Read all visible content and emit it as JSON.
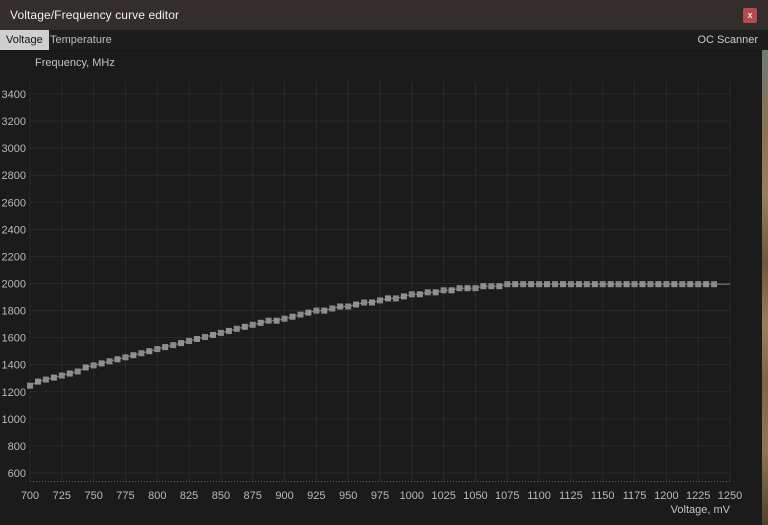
{
  "window": {
    "title": "Voltage/Frequency curve editor",
    "close_label": "x"
  },
  "tabs": {
    "voltage": "Voltage",
    "temperature": "Temperature",
    "oc_scanner": "OC Scanner"
  },
  "chart_data": {
    "type": "scatter",
    "title": "",
    "xlabel": "Voltage, mV",
    "ylabel": "Frequency, MHz",
    "xlim": [
      700,
      1250
    ],
    "ylim": [
      600,
      3400
    ],
    "grid": true,
    "legend": "none",
    "x_ticks": [
      700,
      725,
      750,
      775,
      800,
      825,
      850,
      875,
      900,
      925,
      950,
      975,
      1000,
      1025,
      1050,
      1075,
      1100,
      1125,
      1150,
      1175,
      1200,
      1225,
      1250
    ],
    "y_ticks": [
      3400,
      3200,
      3000,
      2800,
      2600,
      2400,
      2200,
      2000,
      1800,
      1600,
      1400,
      1200,
      1000,
      800,
      600
    ],
    "series": [
      {
        "name": "voltage-frequency-curve",
        "marker": "square",
        "marker_step_mv": 6.25,
        "freq_quantize_mhz": 15,
        "markers_end_mv": 1237.5,
        "line_end_mv": 1250,
        "points": [
          [
            700,
            1250.0
          ],
          [
            725,
            1321.6
          ],
          [
            750,
            1390.7
          ],
          [
            775,
            1457.1
          ],
          [
            800,
            1520.7
          ],
          [
            825,
            1581.3
          ],
          [
            850,
            1639.0
          ],
          [
            875,
            1693.6
          ],
          [
            900,
            1744.9
          ],
          [
            925,
            1792.8
          ],
          [
            950,
            1836.9
          ],
          [
            975,
            1877.2
          ],
          [
            1000,
            1913.2
          ],
          [
            1025,
            1944.6
          ],
          [
            1050,
            1970.5
          ],
          [
            1075,
            1990.0
          ],
          [
            1100,
            2000.0
          ],
          [
            1250,
            2000.0
          ]
        ]
      }
    ],
    "colors": {
      "background": "#1b1b1b",
      "grid": "#2a2a2a",
      "marker": "#919191",
      "marker_alt": "#898989",
      "line": "#7a7a7a",
      "tick_text": "#b9b9b9",
      "dotted_baseline": "#626262"
    }
  },
  "colors": {
    "titlebar": "#332e2b",
    "title_text": "#efefef",
    "close_button": "#b34b4b",
    "tabbar": "#1d1d1d",
    "selected_tab_bg": "#cfcfcf",
    "selected_tab_text": "#141414",
    "tab_text": "#bdbdbd"
  }
}
